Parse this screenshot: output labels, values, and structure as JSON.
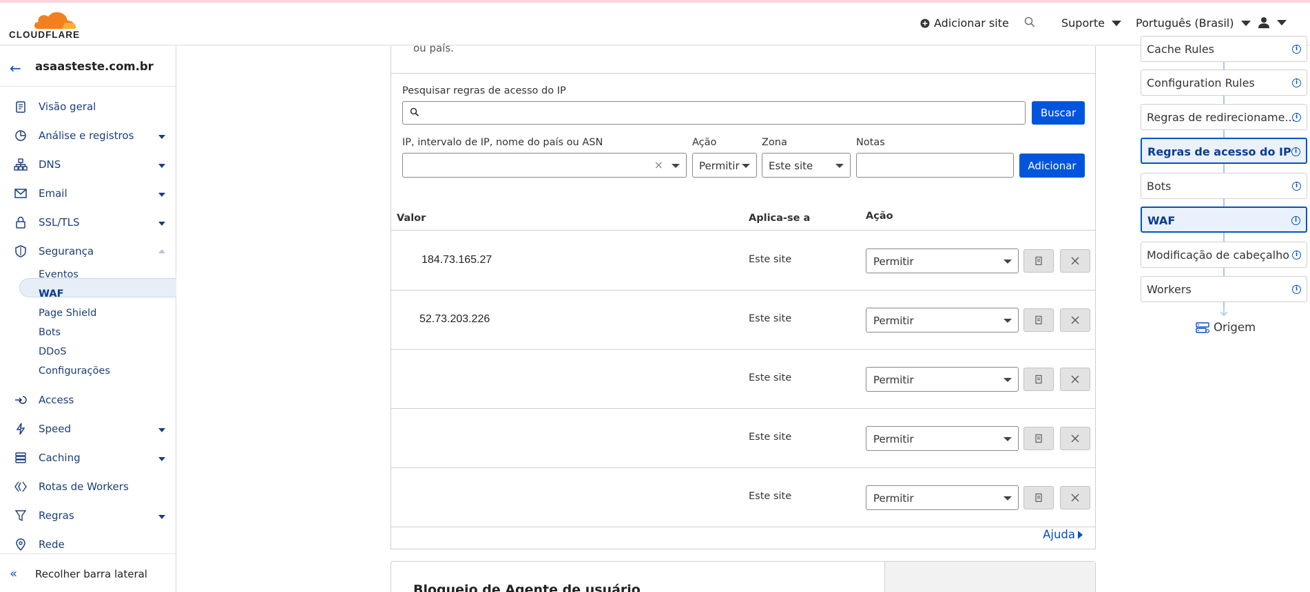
{
  "header": {
    "logo_text": "CLOUDFLARE",
    "add_site": "Adicionar site",
    "support": "Suporte",
    "language": "Português (Brasil)"
  },
  "sidebar": {
    "site_name": "asaasteste.com.br",
    "items": [
      {
        "label": "Visão geral",
        "icon": "clipboard-icon",
        "chevron": false
      },
      {
        "label": "Análise e registros",
        "icon": "pie-chart-icon",
        "chevron": true
      },
      {
        "label": "DNS",
        "icon": "network-icon",
        "chevron": true
      },
      {
        "label": "Email",
        "icon": "email-icon",
        "chevron": true
      },
      {
        "label": "SSL/TLS",
        "icon": "lock-icon",
        "chevron": true
      },
      {
        "label": "Segurança",
        "icon": "shield-icon",
        "chevron": true
      }
    ],
    "security_sub": [
      "Eventos",
      "WAF",
      "Page Shield",
      "Bots",
      "DDoS",
      "Configurações"
    ],
    "items_after": [
      {
        "label": "Access",
        "icon": "access-icon",
        "chevron": false
      },
      {
        "label": "Speed",
        "icon": "lightning-icon",
        "chevron": true
      },
      {
        "label": "Caching",
        "icon": "stack-icon",
        "chevron": true
      },
      {
        "label": "Rotas de Workers",
        "icon": "workers-icon",
        "chevron": false
      },
      {
        "label": "Regras",
        "icon": "funnel-icon",
        "chevron": true
      },
      {
        "label": "Rede",
        "icon": "location-pin-icon",
        "chevron": false
      }
    ],
    "collapse": "Recolher barra lateral"
  },
  "main": {
    "top_text": "ou país.",
    "search_label": "Pesquisar regras de acesso do IP",
    "search_value": "",
    "search_button": "Buscar",
    "ip_label": "IP, intervalo de IP, nome do país ou ASN",
    "action_label": "Ação",
    "action_value": "Permitir",
    "zone_label": "Zona",
    "zone_value": "Este site",
    "notes_label": "Notas",
    "add_button": "Adicionar",
    "columns": {
      "value": "Valor",
      "applies": "Aplica-se a",
      "action": "Ação"
    },
    "rows": [
      {
        "ip": "184.73.165.27",
        "zone": "Este site",
        "action": "Permitir"
      },
      {
        "ip": "52.73.203.226",
        "zone": "Este site",
        "action": "Permitir"
      },
      {
        "ip": "",
        "zone": "Este site",
        "action": "Permitir"
      },
      {
        "ip": "",
        "zone": "Este site",
        "action": "Permitir"
      },
      {
        "ip": "",
        "zone": "Este site",
        "action": "Permitir"
      }
    ],
    "help": "Ajuda",
    "next_card_title": "Bloqueio de Agente de usuário"
  },
  "pipeline": {
    "items": [
      {
        "label": "Cache Rules",
        "active": false
      },
      {
        "label": "Configuration Rules",
        "active": false
      },
      {
        "label": "Regras de redirecioname...",
        "active": false
      },
      {
        "label": "Regras de acesso do IP",
        "active": true
      },
      {
        "label": "Bots",
        "active": false
      },
      {
        "label": "WAF",
        "active": true
      },
      {
        "label": "Modificação de cabeçalho",
        "active": false
      },
      {
        "label": "Workers",
        "active": false
      }
    ],
    "origin": "Origem"
  },
  "colors": {
    "accent": "#0055dc",
    "brand_orange": "#f38020",
    "nav_text": "#1a3d7a"
  }
}
